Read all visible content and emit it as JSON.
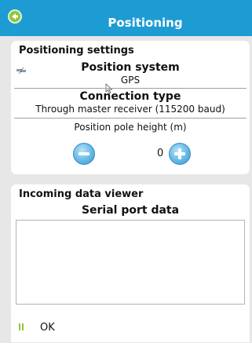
{
  "header": {
    "title": "Positioning"
  },
  "positioning": {
    "section_title": "Positioning settings",
    "position_system_label": "Position system",
    "position_system_value": "GPS",
    "connection_type_label": "Connection type",
    "connection_type_value": "Through master receiver (115200 baud)",
    "pole_height_label": "Position pole height (m)",
    "pole_height_value": "0"
  },
  "incoming": {
    "section_title": "Incoming data viewer",
    "serial_label": "Serial port data",
    "serial_data": ""
  },
  "status": {
    "text": "OK"
  },
  "colors": {
    "header": "#1d9cd3",
    "back_button": "#8dc63f",
    "background": "#e7e7e7",
    "stepper": "#64b9e6"
  },
  "icons": [
    "back-arrow-icon",
    "satellite-icon",
    "minus-icon",
    "plus-icon",
    "ok-status-icon",
    "mouse-cursor-icon"
  ]
}
